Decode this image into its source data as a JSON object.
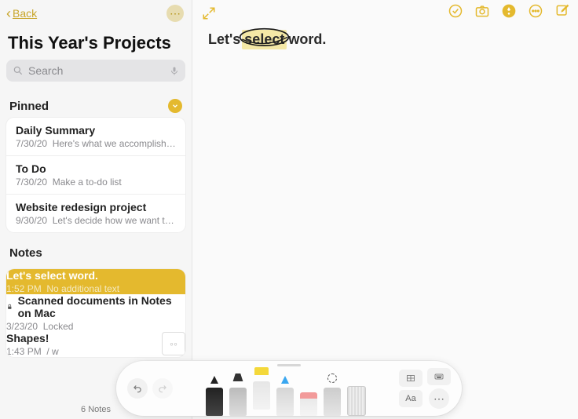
{
  "nav": {
    "back_label": "Back",
    "folder_title": "This Year's Projects",
    "search_placeholder": "Search"
  },
  "sections": {
    "pinned_label": "Pinned",
    "notes_label": "Notes"
  },
  "pinned": [
    {
      "title": "Daily Summary",
      "date": "7/30/20",
      "preview": "Here's what we accomplished to…"
    },
    {
      "title": "To Do",
      "date": "7/30/20",
      "preview": "Make a to-do list"
    },
    {
      "title": "Website redesign project",
      "date": "9/30/20",
      "preview": "Let's decide how we want to red…"
    }
  ],
  "notes": [
    {
      "title": "Let's select word.",
      "date": "1:52 PM",
      "preview": "No additional text",
      "selected": true
    },
    {
      "title": "Scanned documents in Notes on Mac",
      "date": "3/23/20",
      "preview": "Locked",
      "locked": true
    },
    {
      "title": "Shapes!",
      "date": "1:43 PM",
      "preview": "/ w",
      "thumb": true
    }
  ],
  "footer": {
    "count_label": "6 Notes"
  },
  "editor": {
    "line_prefix": "Let's ",
    "highlighted": "select",
    "line_suffix": " word."
  },
  "colors": {
    "accent": "#e4b92e"
  }
}
